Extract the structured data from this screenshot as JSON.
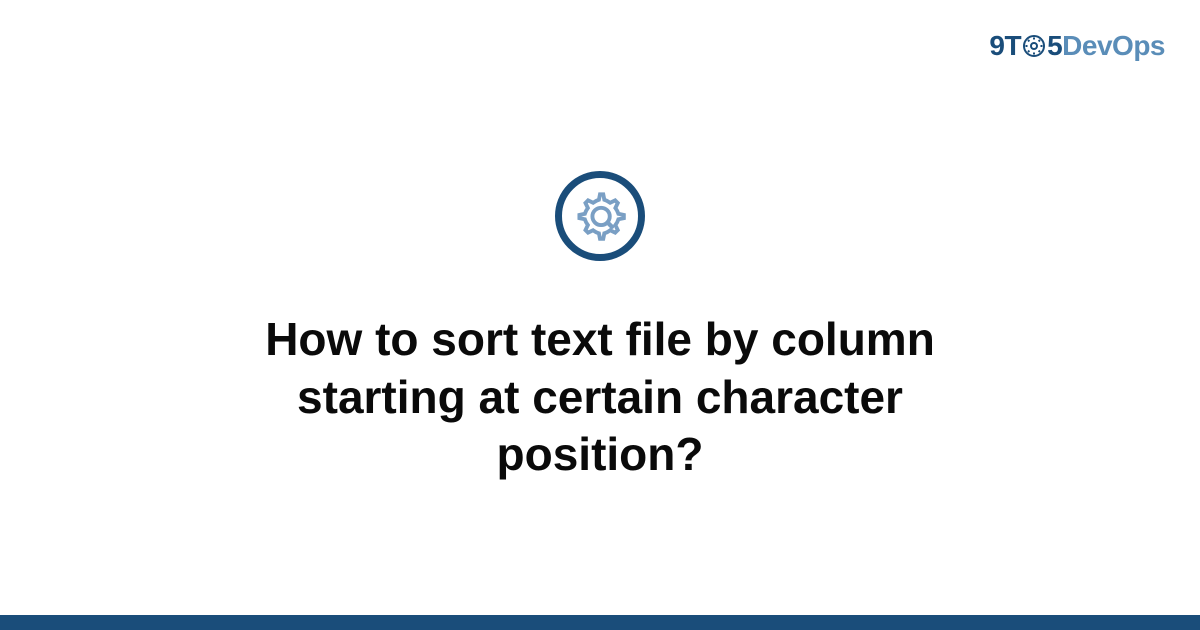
{
  "logo": {
    "prefix": "9T",
    "middle": "5",
    "suffix": "DevOps"
  },
  "icon": {
    "name": "gear-icon"
  },
  "title": "How to sort text file by column starting at certain character position?",
  "colors": {
    "primary": "#1a4d7a",
    "secondary": "#5a8db8",
    "text": "#0a0a0a"
  }
}
